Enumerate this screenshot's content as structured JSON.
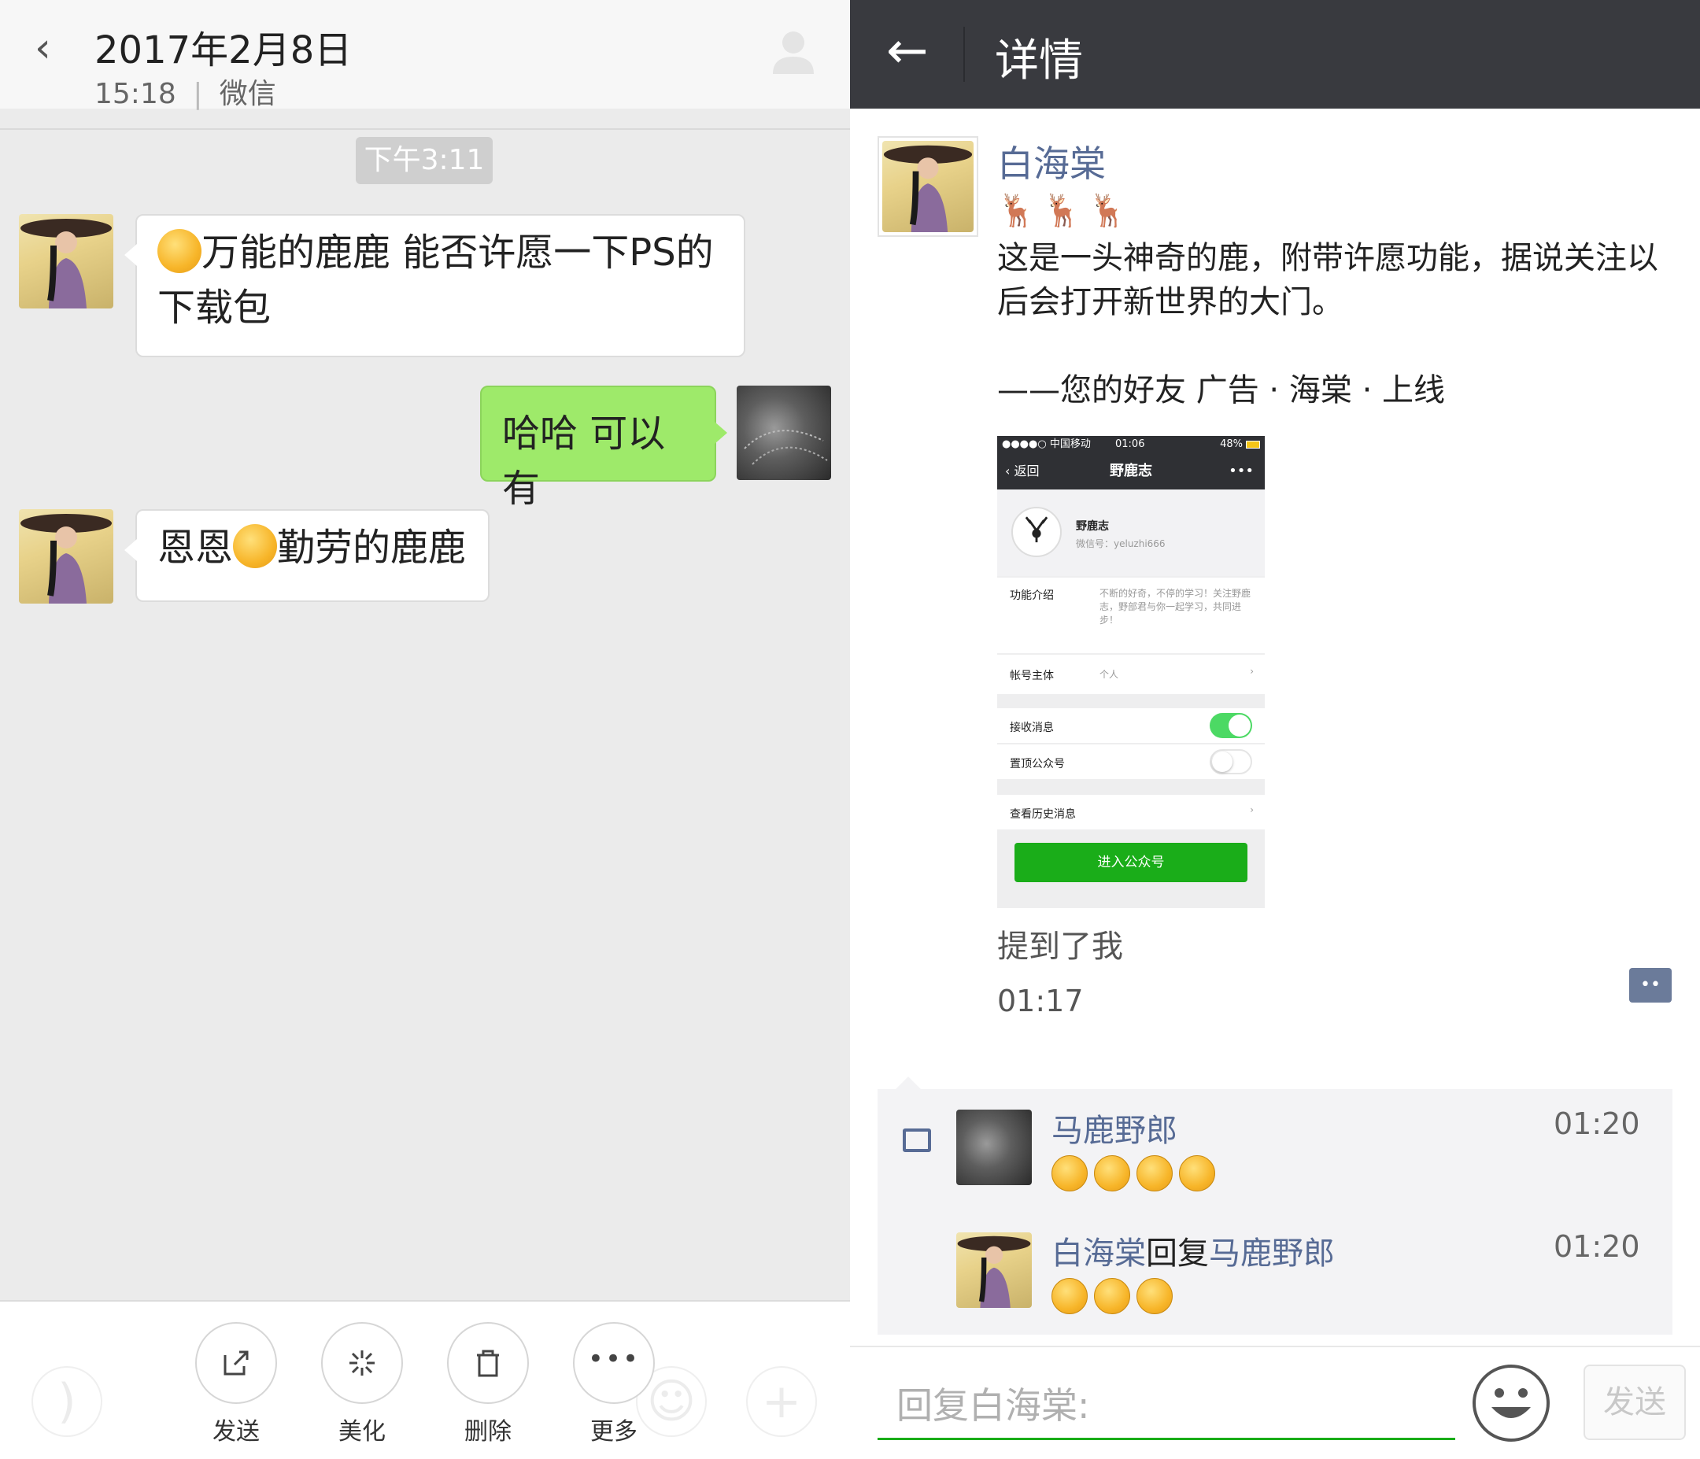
{
  "left": {
    "header": {
      "title": "2017年2月8日",
      "time": "15:18",
      "source": "微信"
    },
    "time_stamp": "下午3:11",
    "messages": [
      {
        "side": "left",
        "text": "万能的鹿鹿 能否许愿一下PS的下载包"
      },
      {
        "side": "right",
        "text": "哈哈 可以有"
      },
      {
        "side": "left",
        "text_a": "恩恩",
        "text_b": "勤劳的鹿鹿"
      }
    ],
    "actions": [
      {
        "label": "发送",
        "icon": "share-icon"
      },
      {
        "label": "美化",
        "icon": "magic-icon"
      },
      {
        "label": "删除",
        "icon": "trash-icon"
      },
      {
        "label": "更多",
        "icon": "more-dots-icon"
      }
    ]
  },
  "right": {
    "header": {
      "title": "详情"
    },
    "post": {
      "author": "白海棠",
      "deer": "🦌🦌🦌",
      "text": "这是一头神奇的鹿，附带许愿功能，据说关注以后会打开新世界的大门。\n\n——您的好友 广告 · 海棠 · 上线",
      "mention": "提到了我",
      "time": "01:17"
    },
    "screenshot": {
      "status_left": "●●●●○ 中国移动",
      "status_time": "01:06",
      "status_right": "48%",
      "nav_back": "返回",
      "nav_title": "野鹿志",
      "nav_more": "•••",
      "account_name": "野鹿志",
      "account_id": "微信号：yeluzhi666",
      "intro_label": "功能介绍",
      "intro_text": "不断的好奇，不停的学习！关注野鹿志，野部君与你一起学习，共同进步！",
      "owner_label": "帐号主体",
      "owner_value": "个人",
      "receive_label": "接收消息",
      "pin_label": "置顶公众号",
      "history_label": "查看历史消息",
      "enter_button": "进入公众号"
    },
    "comments": [
      {
        "name": "马鹿野郎",
        "time": "01:20",
        "emoji_count": 4
      },
      {
        "name": "白海棠",
        "reply_word": "回复",
        "reply_to": "马鹿野郎",
        "time": "01:20",
        "emoji_count": 3
      }
    ],
    "reply_placeholder": "回复白海棠:",
    "send_label": "发送"
  }
}
